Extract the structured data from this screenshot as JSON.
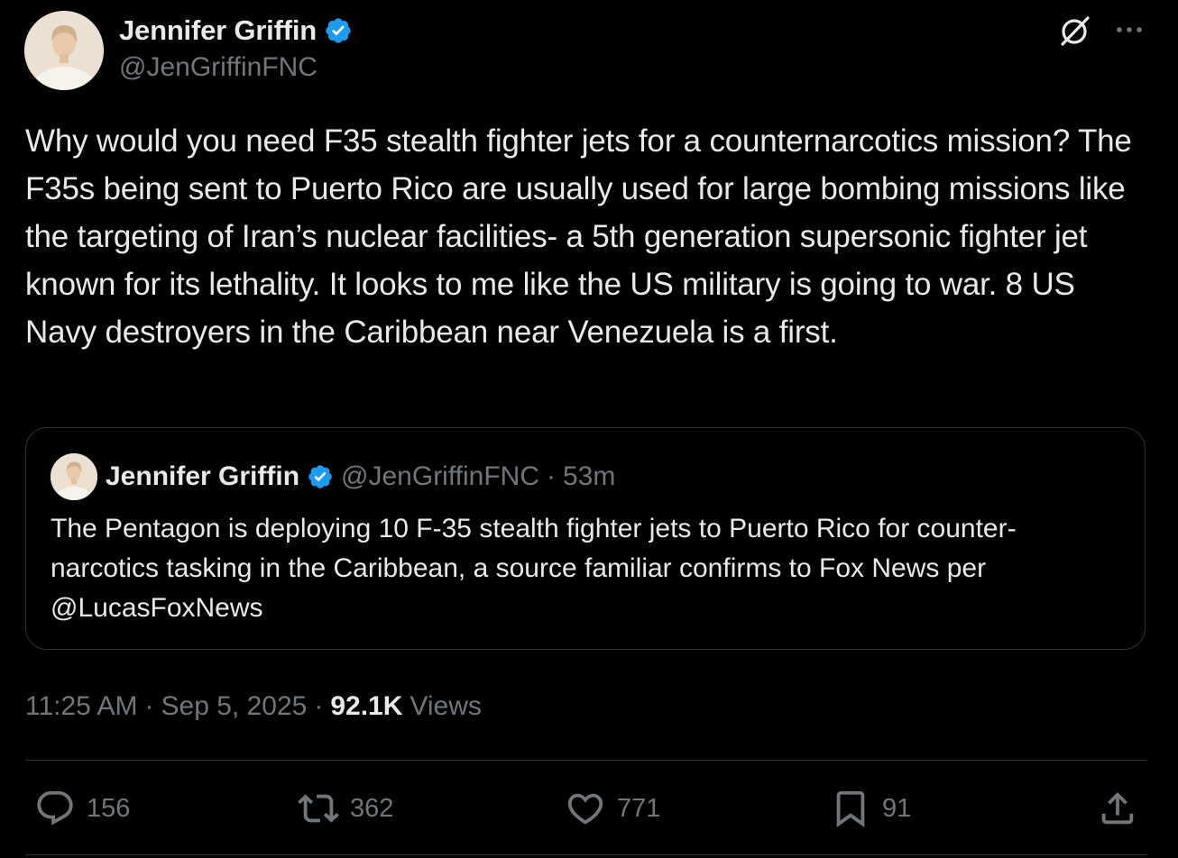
{
  "author": {
    "name": "Jennifer Griffin",
    "handle": "@JenGriffinFNC",
    "verified": true,
    "verified_color": "#1d9bf0"
  },
  "header_icons": {
    "grok": "grok-icon",
    "more": "more-options-icon"
  },
  "tweet": {
    "text": "Why would you need F35 stealth fighter jets for a counternarcotics mission? The F35s being sent to Puerto Rico are usually used for large bombing missions like the targeting of Iran’s nuclear facilities- a 5th generation supersonic fighter jet known for its lethality. It looks to me like the US military is going to war. 8 US Navy destroyers in the Caribbean near Venezuela is a first."
  },
  "quote": {
    "name": "Jennifer Griffin",
    "handle": "@JenGriffinFNC",
    "separator": "·",
    "time": "53m",
    "text": "The Pentagon is deploying 10 F-35 stealth fighter jets to Puerto Rico for counter-narcotics tasking in the Caribbean, a source familiar confirms to Fox News per @LucasFoxNews"
  },
  "meta": {
    "time": "11:25 AM",
    "sep1": "·",
    "date": "Sep 5, 2025",
    "sep2": "·",
    "views_count": "92.1K",
    "views_label": "Views"
  },
  "actions": {
    "replies": "156",
    "reposts": "362",
    "likes": "771",
    "bookmarks": "91"
  },
  "colors": {
    "background": "#000000",
    "text_primary": "#e7e9ea",
    "text_secondary": "#71767b",
    "border": "#2f3336",
    "accent": "#1d9bf0"
  }
}
